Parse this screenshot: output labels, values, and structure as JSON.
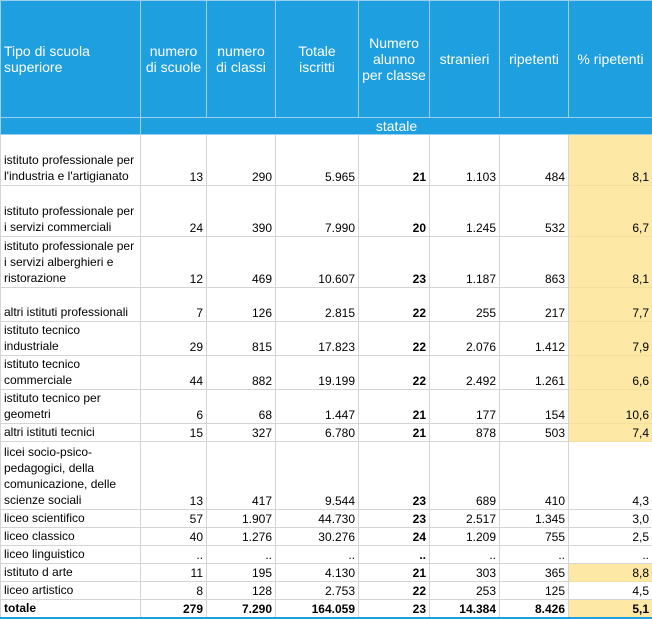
{
  "headers": {
    "tipo": "Tipo di scuola superiore",
    "numero_scuole": "numero di scuole",
    "numero_classi": "numero di classi",
    "totale_iscritti": "Totale iscritti",
    "alunno_per_classe": "Numero alunno per classe",
    "stranieri": "stranieri",
    "ripetenti": "ripetenti",
    "pct_ripetenti": "% ripetenti"
  },
  "subheader": "statale",
  "rows": [
    {
      "name": "istituto professionale per l'industria e l'artigianato",
      "scuole": "13",
      "classi": "290",
      "iscritti": "5.965",
      "per_classe": "21",
      "stranieri": "1.103",
      "ripetenti": "484",
      "pct": "8,1"
    },
    {
      "name": "istituto professionale per i servizi commerciali",
      "scuole": "24",
      "classi": "390",
      "iscritti": "7.990",
      "per_classe": "20",
      "stranieri": "1.245",
      "ripetenti": "532",
      "pct": "6,7"
    },
    {
      "name": "istituto professionale per i servizi alberghieri e ristorazione",
      "scuole": "12",
      "classi": "469",
      "iscritti": "10.607",
      "per_classe": "23",
      "stranieri": "1.187",
      "ripetenti": "863",
      "pct": "8,1"
    },
    {
      "name": "altri istituti professionali",
      "scuole": "7",
      "classi": "126",
      "iscritti": "2.815",
      "per_classe": "22",
      "stranieri": "255",
      "ripetenti": "217",
      "pct": "7,7"
    },
    {
      "name": "istituto tecnico industriale",
      "scuole": "29",
      "classi": "815",
      "iscritti": "17.823",
      "per_classe": "22",
      "stranieri": "2.076",
      "ripetenti": "1.412",
      "pct": "7,9"
    },
    {
      "name": "istituto tecnico commerciale",
      "scuole": "44",
      "classi": "882",
      "iscritti": "19.199",
      "per_classe": "22",
      "stranieri": "2.492",
      "ripetenti": "1.261",
      "pct": "6,6"
    },
    {
      "name": "istituto tecnico per geometri",
      "scuole": "6",
      "classi": "68",
      "iscritti": "1.447",
      "per_classe": "21",
      "stranieri": "177",
      "ripetenti": "154",
      "pct": "10,6"
    },
    {
      "name": "altri istituti tecnici",
      "scuole": "15",
      "classi": "327",
      "iscritti": "6.780",
      "per_classe": "21",
      "stranieri": "878",
      "ripetenti": "503",
      "pct": "7,4"
    },
    {
      "name": "licei socio-psico-pedagogici, della comunicazione, delle scienze sociali",
      "scuole": "13",
      "classi": "417",
      "iscritti": "9.544",
      "per_classe": "23",
      "stranieri": "689",
      "ripetenti": "410",
      "pct": "4,3"
    },
    {
      "name": "liceo scientifico",
      "scuole": "57",
      "classi": "1.907",
      "iscritti": "44.730",
      "per_classe": "23",
      "stranieri": "2.517",
      "ripetenti": "1.345",
      "pct": "3,0"
    },
    {
      "name": "liceo classico",
      "scuole": "40",
      "classi": "1.276",
      "iscritti": "30.276",
      "per_classe": "24",
      "stranieri": "1.209",
      "ripetenti": "755",
      "pct": "2,5"
    },
    {
      "name": "liceo linguistico",
      "scuole": "..",
      "classi": "..",
      "iscritti": "..",
      "per_classe": "..",
      "stranieri": "..",
      "ripetenti": "..",
      "pct": ".."
    },
    {
      "name": "istituto d arte",
      "scuole": "11",
      "classi": "195",
      "iscritti": "4.130",
      "per_classe": "21",
      "stranieri": "303",
      "ripetenti": "365",
      "pct": "8,8"
    },
    {
      "name": "liceo artistico",
      "scuole": "8",
      "classi": "128",
      "iscritti": "2.753",
      "per_classe": "22",
      "stranieri": "253",
      "ripetenti": "125",
      "pct": "4,5"
    }
  ],
  "total": {
    "name": "totale",
    "scuole": "279",
    "classi": "7.290",
    "iscritti": "164.059",
    "per_classe": "23",
    "stranieri": "14.384",
    "ripetenti": "8.426",
    "pct": "5,1"
  },
  "colors": {
    "header_bg": "#1e9fe0",
    "highlight_bg": "#fde8a6"
  }
}
